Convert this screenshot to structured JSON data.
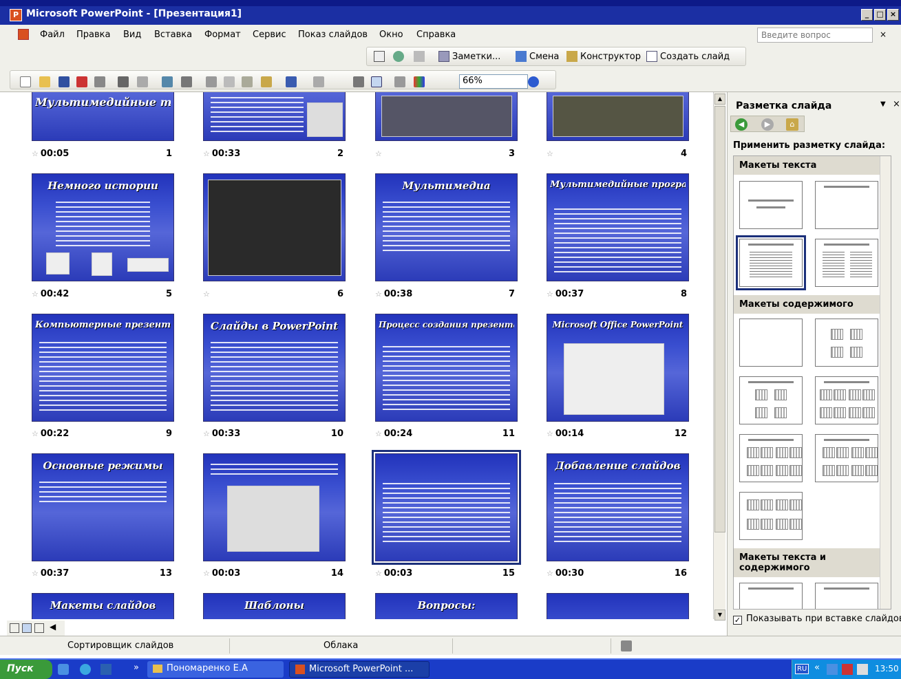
{
  "window": {
    "title": "Microsoft PowerPoint - [Презентация1]",
    "min": "_",
    "max": "□",
    "close": "×"
  },
  "menu": {
    "items": [
      "Файл",
      "Правка",
      "Вид",
      "Вставка",
      "Формат",
      "Сервис",
      "Показ слайдов",
      "Окно",
      "Справка"
    ],
    "ask_placeholder": "Введите вопрос",
    "ask_close": "×"
  },
  "toolbar2": {
    "notes": "Заметки...",
    "transition": "Смена",
    "designer": "Конструктор",
    "new_slide": "Создать слайд"
  },
  "toolbar3": {
    "zoom": "66%"
  },
  "slides": [
    {
      "title": "Мультимедийные технологии",
      "time": "00:05",
      "num": "1"
    },
    {
      "title": "",
      "time": "00:33",
      "num": "2"
    },
    {
      "title": "",
      "time": "",
      "num": "3"
    },
    {
      "title": "",
      "time": "",
      "num": "4"
    },
    {
      "title": "Немного истории",
      "time": "00:42",
      "num": "5"
    },
    {
      "title": "",
      "time": "",
      "num": "6"
    },
    {
      "title": "Мультимедиа",
      "time": "00:38",
      "num": "7"
    },
    {
      "title": "Мультимедийные программные средства",
      "time": "00:37",
      "num": "8"
    },
    {
      "title": "Компьютерные презентации",
      "time": "00:22",
      "num": "9"
    },
    {
      "title": "Слайды в PowerPoint",
      "time": "00:33",
      "num": "10"
    },
    {
      "title": "Процесс создания презентации",
      "time": "00:24",
      "num": "11"
    },
    {
      "title": "Microsoft Office PowerPoint",
      "time": "00:14",
      "num": "12"
    },
    {
      "title": "Основные режимы",
      "time": "00:37",
      "num": "13"
    },
    {
      "title": "",
      "time": "00:03",
      "num": "14"
    },
    {
      "title": "",
      "time": "00:03",
      "num": "15"
    },
    {
      "title": "Добавление слайдов",
      "time": "00:30",
      "num": "16"
    },
    {
      "title": "Макеты слайдов",
      "time": "",
      "num": ""
    },
    {
      "title": "Шаблоны",
      "time": "",
      "num": ""
    },
    {
      "title": "Вопросы:",
      "time": "",
      "num": ""
    },
    {
      "title": "",
      "time": "",
      "num": ""
    }
  ],
  "pane": {
    "title": "Разметка слайда",
    "close": "×",
    "apply": "Применить разметку слайда:",
    "sec_text": "Макеты текста",
    "sec_content": "Макеты содержимого",
    "sec_text_content": "Макеты текста и содержимого",
    "show_on_insert": "Показывать при вставке слайдов",
    "check": "✓"
  },
  "status": {
    "view": "Сортировщик слайдов",
    "design": "Облака"
  },
  "taskbar": {
    "start": "Пуск",
    "folder": "Пономаренко Е.А",
    "app": "Microsoft PowerPoint ...",
    "lang": "RU",
    "clock": "13:50",
    "more": "»"
  },
  "colors": {
    "title_bar": "#1b2fa3",
    "slide_bg": "#3a4fd0",
    "taskbar": "#1a3cc8",
    "start": "#3a9a3a"
  }
}
